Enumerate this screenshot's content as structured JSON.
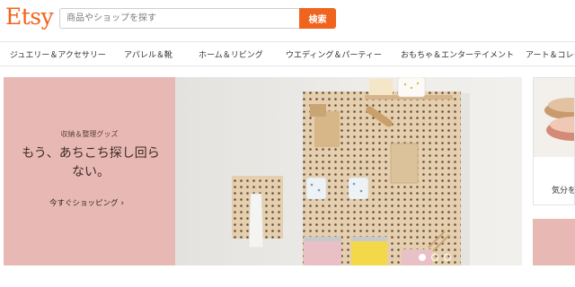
{
  "header": {
    "logo": "Etsy",
    "search": {
      "placeholder": "商品やショップを探す",
      "button_label": "検索"
    }
  },
  "nav": {
    "items": [
      {
        "label": "ジュエリー＆アクセサリー"
      },
      {
        "label": "アパレル＆靴"
      },
      {
        "label": "ホーム＆リビング"
      },
      {
        "label": "ウエディング＆パーティー"
      },
      {
        "label": "おもちゃ＆エンターテイメント"
      },
      {
        "label": "アート＆コレク"
      }
    ]
  },
  "hero": {
    "kicker": "収納＆整理グッズ",
    "headline": "もう、あちこち探し回らない。",
    "cta": "今すぐショッピング",
    "cta_icon": "chevron-right-icon",
    "slides": {
      "count": 3,
      "active": 1
    },
    "colors": {
      "panel": "#e8b9b4",
      "accent": "#f1641e"
    }
  },
  "side_card": {
    "text": "気分を"
  }
}
